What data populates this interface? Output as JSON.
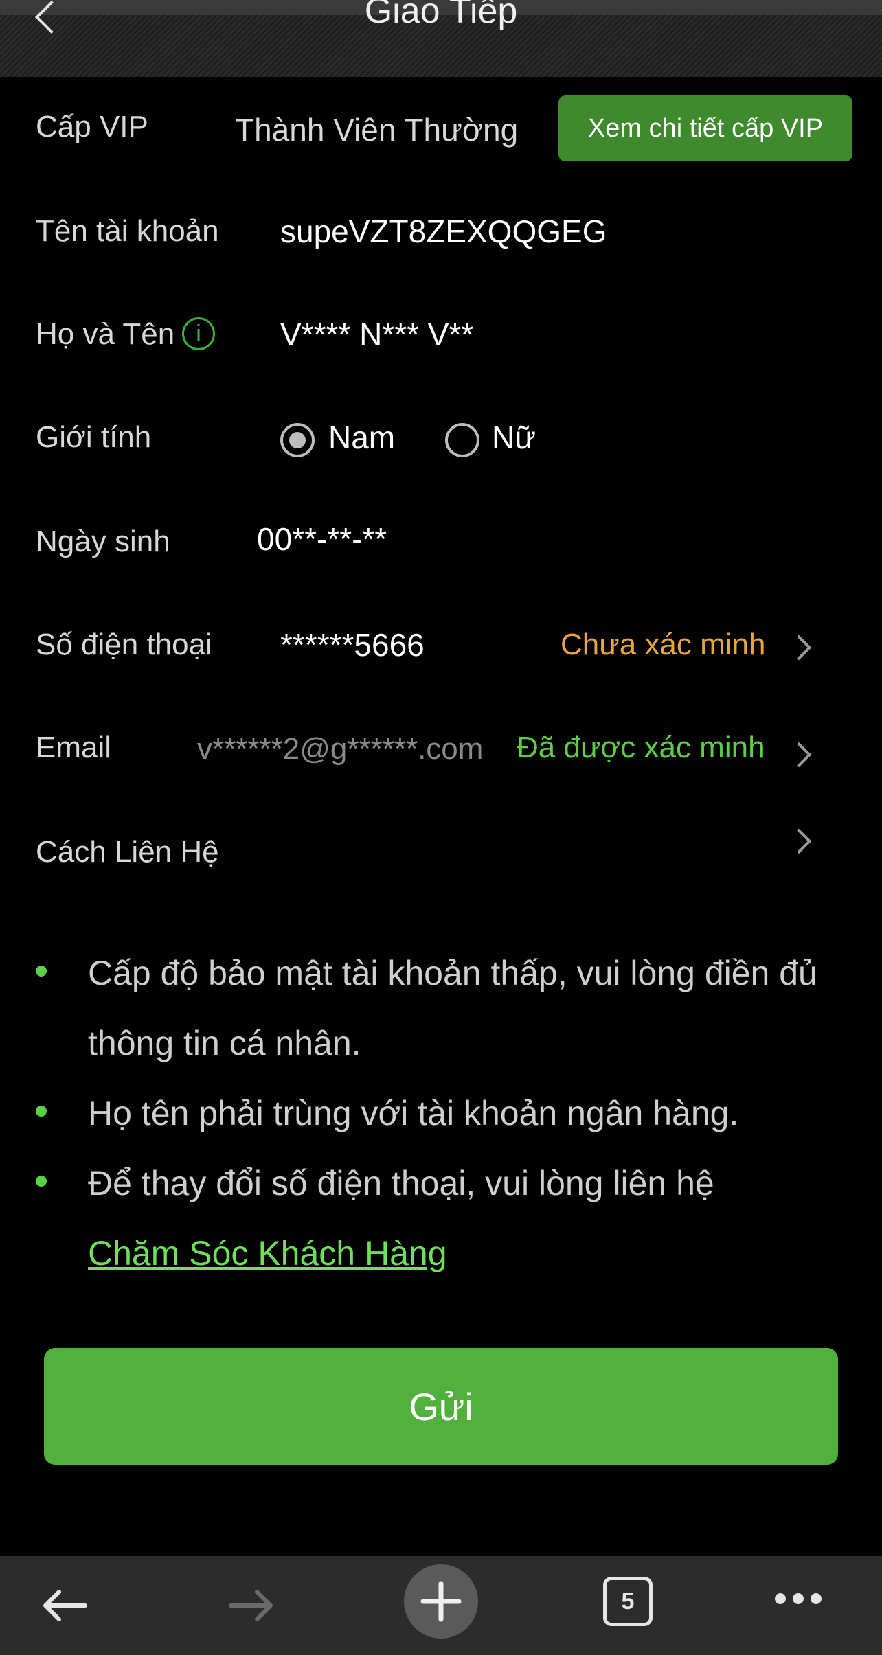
{
  "header": {
    "title": "Giao Tiếp"
  },
  "vip": {
    "label": "Cấp VIP",
    "value": "Thành Viên Thường",
    "button": "Xem chi tiết cấp VIP"
  },
  "account": {
    "label": "Tên tài khoản",
    "value": "supeVZT8ZEXQQGEG"
  },
  "fullname": {
    "label": "Họ và Tên",
    "info_glyph": "i",
    "value": "V**** N*** V**"
  },
  "gender": {
    "label": "Giới tính",
    "options": [
      "Nam",
      "Nữ"
    ],
    "selected": "Nam"
  },
  "birthday": {
    "label": "Ngày sinh",
    "value": "00**-**-**"
  },
  "phone": {
    "label": "Số điện thoại",
    "value": "******5666",
    "status": "Chưa xác minh",
    "status_color": "#e6a63a"
  },
  "email": {
    "label": "Email",
    "value": "v******2@g******.com",
    "status": "Đã được xác minh",
    "status_color": "#5ccf43"
  },
  "contact": {
    "label": "Cách Liên Hệ"
  },
  "notes": {
    "items": [
      "Cấp độ bảo mật tài khoản thấp, vui lòng điền đủ thông tin cá nhân.",
      "Họ tên phải trùng với tài khoản ngân hàng.",
      "Để thay đổi số điện thoại, vui lòng liên hệ"
    ],
    "support_link": "Chăm Sóc Khách Hàng"
  },
  "submit": {
    "label": "Gửi"
  },
  "browser": {
    "tab_count": "5"
  },
  "colors": {
    "accent_green": "#52b13d",
    "button_green": "#3e8a2c",
    "background": "#000000"
  },
  "icons": [
    "back-chevron-icon",
    "info-icon",
    "chevron-right-icon",
    "back-arrow-icon",
    "forward-arrow-icon",
    "plus-icon",
    "tabs-icon",
    "more-icon"
  ]
}
